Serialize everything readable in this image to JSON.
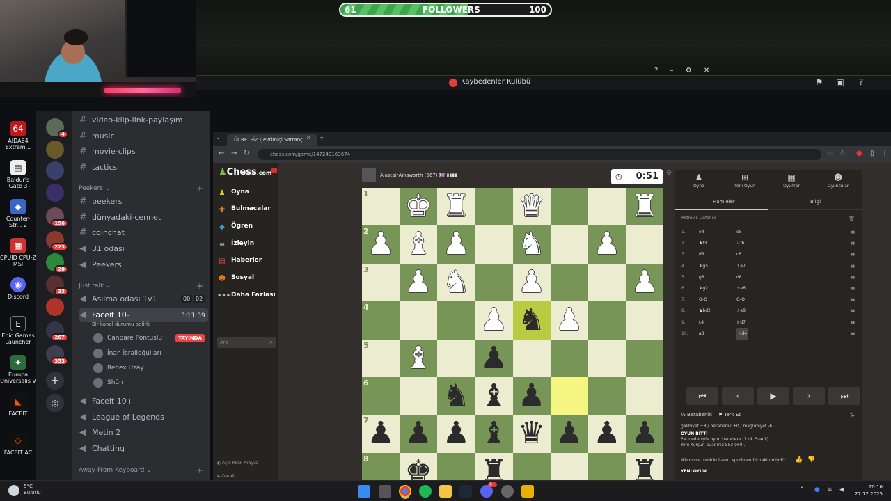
{
  "overlay": {
    "followers_current": "61",
    "followers_label": "FOLLOWERS",
    "followers_goal": "100",
    "followers_progress": 0.61
  },
  "window": {
    "title": "Kaybedenler Kulübü"
  },
  "desktop_icons": [
    {
      "label": "AIDA64 Extrem..."
    },
    {
      "label": "Baldur's Gate 3"
    },
    {
      "label": "Counter-Str... 2"
    },
    {
      "label": "CPUID CPU-Z MSI"
    },
    {
      "label": "Discord"
    },
    {
      "label": "Epic Games Launcher"
    },
    {
      "label": "Europa Universalis V"
    },
    {
      "label": "FACEIT"
    },
    {
      "label": "FACEIT AC"
    }
  ],
  "discord": {
    "server_badges": [
      "4",
      "156",
      "223",
      "20",
      "33",
      "267",
      "353"
    ],
    "text_channels": [
      "video-klip-link-paylaşım",
      "music",
      "movie-clips",
      "tactics"
    ],
    "peekers_category": "Peekers",
    "peekers_channels": [
      "peekers",
      "dünyadaki-cennet",
      "coinchat",
      "31 odası",
      "Peekers"
    ],
    "just_talk_category": "Just talk",
    "voice_asilma": "Asılma odası 1v1",
    "voice_asilma_counts": [
      "00",
      "02"
    ],
    "voice_faceit": "Faceit 10-",
    "voice_faceit_time": "3:11:39",
    "voice_faceit_status": "Bir kanal durumu belirle",
    "voice_users": [
      "Canpare Pontuslu",
      "İnan İsrailoğulları",
      "Reflex Uzay",
      "Shûn"
    ],
    "live_badge": "YAYINDA",
    "voice_more": [
      "Faceit 10+",
      "League of Legends",
      "Metin 2",
      "Chatting"
    ],
    "afk_category": "Away From Keyboard"
  },
  "browser": {
    "tab_title": "ÜCRETSİZ Çevrimiçi Satranç",
    "url": "chess.com/game/147249163674"
  },
  "chess": {
    "logo_main": "Chess",
    "logo_suffix": ".com",
    "nav": [
      "Oyna",
      "Bulmacalar",
      "Öğren",
      "İzleyin",
      "Haberler",
      "Sosyal",
      "Daha Fazlası"
    ],
    "search_placeholder": "Ara",
    "light_ui": "Açık Renk Arayüz",
    "collapse": "Daralt",
    "opponent": "AlastairAinsworth (567) 🇬🇧 ▮▮▮▮",
    "clock": "0:51",
    "panel_tabs": [
      "Oyna",
      "Yeni Oyun",
      "Oyunlar",
      "Oyuncular"
    ],
    "sub_tabs": [
      "Hamleler",
      "Bilgi"
    ],
    "opening": "Petrov's Defense",
    "moves": [
      {
        "n": "1.",
        "w": "e4",
        "b": "e5"
      },
      {
        "n": "2.",
        "w": "♞f3",
        "b": "♘f6"
      },
      {
        "n": "3.",
        "w": "d3",
        "b": "c6"
      },
      {
        "n": "4.",
        "w": "♝g5",
        "b": "♗e7"
      },
      {
        "n": "5.",
        "w": "g3",
        "b": "d6"
      },
      {
        "n": "6.",
        "w": "♝g2",
        "b": "♗e6"
      },
      {
        "n": "7.",
        "w": "O-O",
        "b": "O-O"
      },
      {
        "n": "8.",
        "w": "♞bd2",
        "b": "♗e8"
      },
      {
        "n": "9.",
        "w": "c4",
        "b": "♕d7"
      },
      {
        "n": "10.",
        "w": "a3",
        "b": "♘d4"
      }
    ],
    "controls": [
      "⏮",
      "‹",
      "▶",
      "›",
      "⏭"
    ],
    "draw_label": "Beraberlik",
    "resign_label": "Terk Et",
    "score_line": "galibiyet +8 / beraberlik +0 / mağlubiyet -6",
    "game_over_title": "OYUN BİTTİ",
    "game_over_reason": "Pat nedeniyle oyun berabere (1 dk Puanlı)",
    "rating_line": "Yeni Kurşun puanınız 553 (+0).",
    "follow_question": "N1cossss rumlı kullanıcı sporlmen bir rakip miydi?",
    "new_game": "YENİ OYUN",
    "rank_labels": [
      "1",
      "2",
      "3",
      "4",
      "5",
      "6",
      "7",
      "8"
    ],
    "board": [
      [
        "",
        "wK",
        "wR",
        "",
        "wQ",
        "",
        "",
        "wR"
      ],
      [
        "wP",
        "wB",
        "wP",
        "",
        "wN",
        "",
        "wP",
        ""
      ],
      [
        "",
        "wP",
        "wN",
        "",
        "wP",
        "",
        "",
        "wP"
      ],
      [
        "",
        "",
        "",
        "wP",
        "bN",
        "wP",
        "",
        ""
      ],
      [
        "",
        "wB",
        "",
        "bP",
        "",
        "",
        "",
        ""
      ],
      [
        "",
        "",
        "bN",
        "bB",
        "bP",
        "",
        "",
        ""
      ],
      [
        "bP",
        "bP",
        "bP",
        "bB",
        "bQ",
        "bP",
        "bP",
        "bP"
      ],
      [
        "",
        "bK",
        "",
        "bR",
        "",
        "",
        "",
        "bR"
      ]
    ]
  },
  "taskbar": {
    "temperature": "5°C",
    "weather": "Bulutlu",
    "time": "20:16",
    "date": "27.12.2025",
    "discord_badge": "9+"
  }
}
